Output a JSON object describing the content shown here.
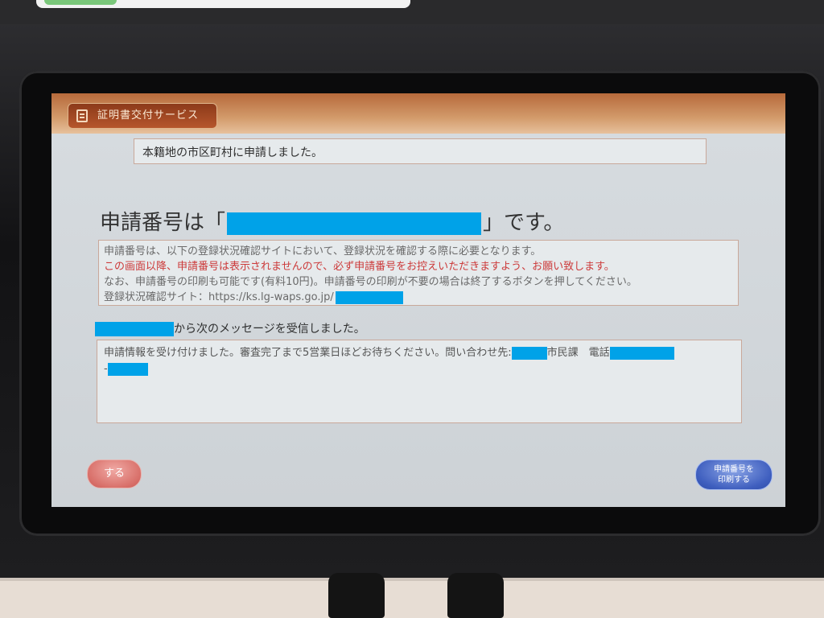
{
  "header": {
    "service_tab_label": "証明書交付サービス",
    "service_icon": "document-icon"
  },
  "registry_notice": "本籍地の市区町村に申請しました。",
  "application_number": {
    "prefix": "申請番号は「",
    "suffix": "」です。"
  },
  "info_box": {
    "line1": "申請番号は、以下の登録状況確認サイトにおいて、登録状況を確認する際に必要となります。",
    "line2": "この画面以降、申請番号は表示されませんので、必ず申請番号をお控えいただきますよう、お願い致します。",
    "line3": "なお、申請番号の印刷も可能です(有料10円)。申請番号の印刷が不要の場合は終了するボタンを押してください。",
    "line4": "登録状況確認サイト：https://ks.lg-waps.go.jp/"
  },
  "received_message": {
    "suffix": "から次のメッセージを受信しました。",
    "body_part1": "申請情報を受け付けました。審査完了まで5営業日ほどお待ちください。問い合わせ先:",
    "body_part2": "市民課　電話",
    "body_part3": "-"
  },
  "buttons": {
    "end_label": "する",
    "print_label": "申請番号を\n印刷する"
  },
  "colors": {
    "redaction": "#00a2e8",
    "warning_text": "#cc3a3a",
    "title_bar": "#c98250",
    "print_button": "#3f5fbf",
    "end_button": "#d9716b"
  }
}
